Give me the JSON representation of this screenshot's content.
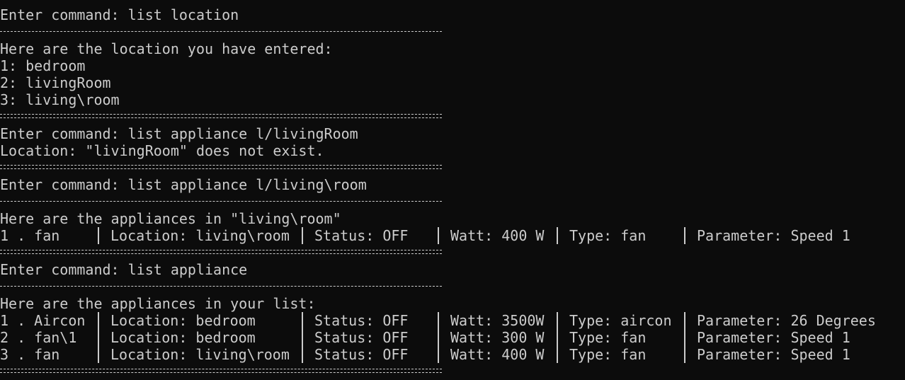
{
  "lines": [
    {
      "type": "text",
      "text": "Enter command: list location"
    },
    {
      "type": "dash"
    },
    {
      "type": "text",
      "text": "Here are the location you have entered:"
    },
    {
      "type": "text",
      "text": "1: bedroom"
    },
    {
      "type": "text",
      "text": "2: livingRoom"
    },
    {
      "type": "text",
      "text": "3: living\\room"
    },
    {
      "type": "double"
    },
    {
      "type": "text",
      "text": "Enter command: list appliance l/livingRoom"
    },
    {
      "type": "text",
      "text": "Location: \"livingRoom\" does not exist."
    },
    {
      "type": "double"
    },
    {
      "type": "text",
      "text": "Enter command: list appliance l/living\\room"
    },
    {
      "type": "dash"
    },
    {
      "type": "text",
      "text": "Here are the appliances in \"living\\room\""
    },
    {
      "type": "row",
      "cells": [
        "1 . fan",
        "Location: living\\room",
        "Status: OFF",
        "Watt: 400 W",
        "Type: fan",
        "Parameter: Speed 1"
      ]
    },
    {
      "type": "double"
    },
    {
      "type": "text",
      "text": "Enter command: list appliance"
    },
    {
      "type": "dash"
    },
    {
      "type": "text",
      "text": "Here are the appliances in your list:"
    },
    {
      "type": "row",
      "cells": [
        "1 . Aircon",
        "Location: bedroom",
        "Status: OFF",
        "Watt: 3500W",
        "Type: aircon",
        "Parameter: 26 Degrees"
      ]
    },
    {
      "type": "row",
      "cells": [
        "2 . fan\\1",
        "Location: bedroom",
        "Status: OFF",
        "Watt: 300 W",
        "Type: fan",
        "Parameter: Speed 1"
      ]
    },
    {
      "type": "row",
      "cells": [
        "3 . fan",
        "Location: living\\room",
        "Status: OFF",
        "Watt: 400 W",
        "Type: fan",
        "Parameter: Speed 1"
      ]
    },
    {
      "type": "double"
    }
  ],
  "colors": {
    "background": "#0c0c0c",
    "foreground": "#cccccc"
  }
}
